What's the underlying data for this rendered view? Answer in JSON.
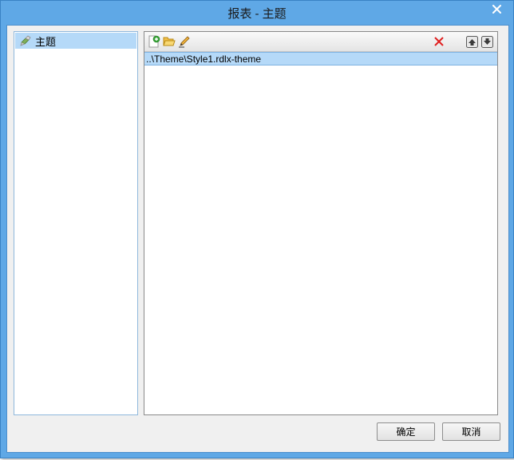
{
  "window": {
    "title": "报表 - 主题"
  },
  "sidebar": {
    "items": [
      {
        "label": "主题",
        "icon": "theme-brush-icon"
      }
    ]
  },
  "toolbar": {
    "icons": [
      "new-theme-icon",
      "open-folder-icon",
      "edit-pencil-icon",
      "delete-x-icon",
      "move-up-icon",
      "move-down-icon"
    ]
  },
  "themes": {
    "rows": [
      {
        "path": "..\\Theme\\Style1.rdlx-theme"
      }
    ]
  },
  "buttons": {
    "ok": "确定",
    "cancel": "取消"
  },
  "colors": {
    "titlebar": "#5fa8e6",
    "selection": "#b5d9f8",
    "delete": "#e02020"
  }
}
